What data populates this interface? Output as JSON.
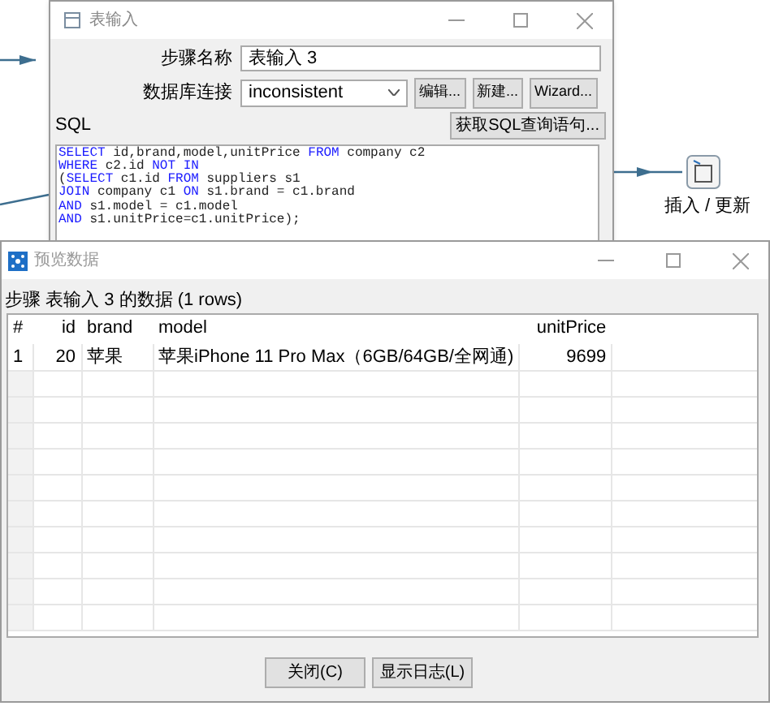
{
  "canvas": {
    "step_label": "插入 / 更新"
  },
  "table_input_dialog": {
    "title": "表输入",
    "step_name": {
      "label": "步骤名称",
      "value": "表输入 3"
    },
    "connection": {
      "label": "数据库连接",
      "value": "inconsistent",
      "buttons": [
        "编辑...",
        "新建...",
        "Wizard..."
      ]
    },
    "sql_label": "SQL",
    "get_sql_button": "获取SQL查询语句...",
    "sql_lines": [
      [
        {
          "kind": "keyword",
          "text": "SELECT"
        },
        {
          "kind": "plain",
          "text": " id,brand,model,unitPrice "
        },
        {
          "kind": "keyword",
          "text": "FROM"
        },
        {
          "kind": "plain",
          "text": " company c2"
        }
      ],
      [
        {
          "kind": "keyword",
          "text": "WHERE"
        },
        {
          "kind": "plain",
          "text": " c2.id "
        },
        {
          "kind": "keyword",
          "text": "NOT IN"
        }
      ],
      [
        {
          "kind": "plain",
          "text": "("
        },
        {
          "kind": "keyword",
          "text": "SELECT"
        },
        {
          "kind": "plain",
          "text": " c1.id "
        },
        {
          "kind": "keyword",
          "text": "FROM"
        },
        {
          "kind": "plain",
          "text": " suppliers s1"
        }
      ],
      [
        {
          "kind": "keyword",
          "text": "JOIN"
        },
        {
          "kind": "plain",
          "text": " company c1 "
        },
        {
          "kind": "keyword",
          "text": "ON"
        },
        {
          "kind": "plain",
          "text": " s1.brand = c1.brand"
        }
      ],
      [
        {
          "kind": "keyword",
          "text": "AND"
        },
        {
          "kind": "plain",
          "text": " s1.model = c1.model"
        }
      ],
      [
        {
          "kind": "keyword",
          "text": "AND"
        },
        {
          "kind": "plain",
          "text": " s1.unitPrice=c1.unitPrice);"
        }
      ]
    ]
  },
  "preview_dialog": {
    "title": "预览数据",
    "caption": "步骤 表输入 3 的数据 (1 rows)",
    "table": {
      "columns": [
        "#",
        "id",
        "brand",
        "model",
        "unitPrice"
      ],
      "rows": [
        [
          "1",
          "20",
          "苹果",
          "苹果iPhone 11 Pro Max（6GB/64GB/全网通)",
          "9699"
        ]
      ]
    },
    "buttons": [
      "关闭(C)",
      "显示日志(L)"
    ]
  }
}
